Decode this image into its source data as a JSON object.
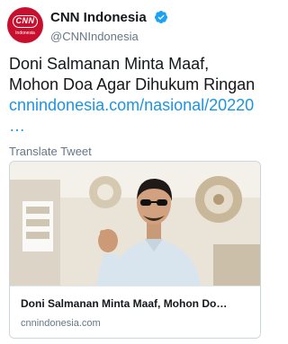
{
  "account": {
    "display_name": "CNN Indonesia",
    "handle": "@CNNIndonesia",
    "avatar_logo": "CNN",
    "avatar_sub": "Indonesia",
    "verified_icon": "verified-badge-icon"
  },
  "tweet": {
    "text_line1": "Doni Salmanan Minta Maaf,",
    "text_line2": "Mohon Doa Agar Dihukum Ringan",
    "link": "cnnindonesia.com/nasional/20220",
    "link_ellipsis": "…",
    "translate_label": "Translate Tweet"
  },
  "card": {
    "title": "Doni Salmanan Minta Maaf, Mohon Do…",
    "domain": "cnnindonesia.com"
  },
  "colors": {
    "brand_red": "#c8102e",
    "link_blue": "#1b95e0",
    "secondary_text": "#657786",
    "card_border": "#ccd6dd"
  }
}
